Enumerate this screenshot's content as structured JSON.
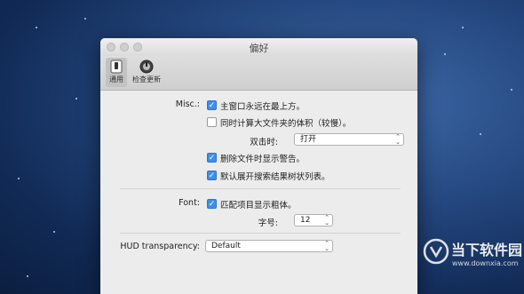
{
  "window": {
    "title": "偏好"
  },
  "toolbar": {
    "items": [
      {
        "label": "通用",
        "selected": true
      },
      {
        "label": "检查更新",
        "selected": false
      }
    ]
  },
  "misc": {
    "label": "Misc.:",
    "options": [
      {
        "label": "主窗口永远在最上方。",
        "checked": true
      },
      {
        "label": "同时计算大文件夹的体积（较慢）。",
        "checked": false
      }
    ],
    "double_click": {
      "label": "双击时:",
      "value": "打开"
    },
    "options2": [
      {
        "label": "删除文件时显示警告。",
        "checked": true
      },
      {
        "label": "默认展开搜索结果树状列表。",
        "checked": true
      }
    ]
  },
  "font": {
    "label": "Font:",
    "bold_match": {
      "label": "匹配项目显示粗体。",
      "checked": true
    },
    "size": {
      "label": "字号:",
      "value": "12"
    }
  },
  "hud": {
    "label": "HUD transparency:",
    "value": "Default"
  },
  "watermark": {
    "name": "当下软件园",
    "url": "www.downxia.com"
  },
  "colors": {
    "accent": "#3d8ef0",
    "window_bg": "#ececec",
    "desktop": "#24477f"
  },
  "icons": {
    "checkmark": "✓",
    "stepper": "⌃⌄"
  }
}
